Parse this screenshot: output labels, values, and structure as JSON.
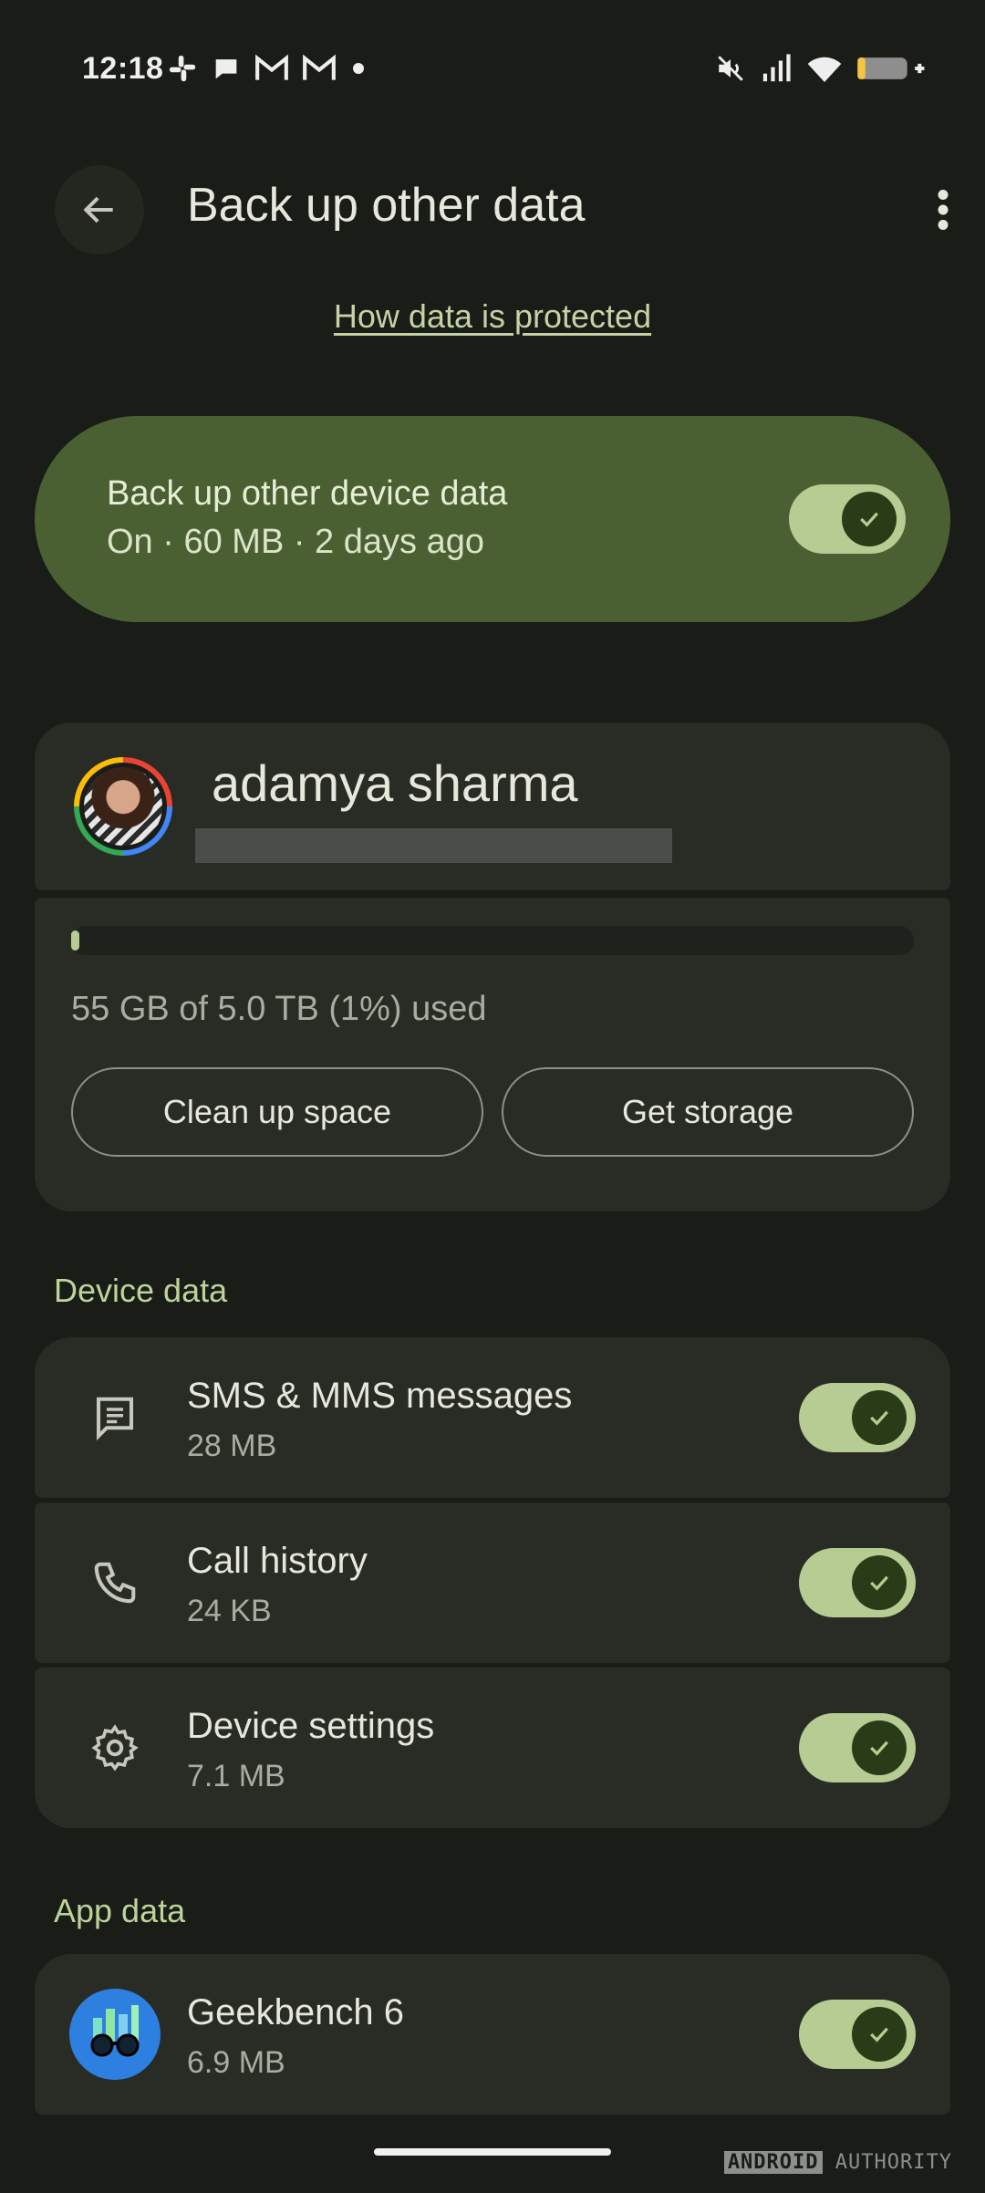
{
  "status_bar": {
    "time": "12:18",
    "left_icons": [
      "slack-icon",
      "chat-bubble-icon",
      "gmail-icon",
      "gmail-icon",
      "dot-icon"
    ],
    "right_icons": [
      "mute-icon",
      "signal-icon",
      "wifi-icon",
      "battery-charging-icon"
    ]
  },
  "header": {
    "title": "Back up other data",
    "back_icon": "arrow-left-icon",
    "more_icon": "more-vertical-icon"
  },
  "protection_link": "How data is protected",
  "backup_toggle": {
    "title": "Back up other device data",
    "subtitle": "On · 60 MB · 2 days ago",
    "enabled": true,
    "accent_color": "#4b6032"
  },
  "account": {
    "name": "adamya sharma"
  },
  "storage": {
    "summary": "55 GB of 5.0 TB (1%) used",
    "used_fraction": 0.01,
    "clean_up_label": "Clean up space",
    "get_storage_label": "Get storage"
  },
  "device_data": {
    "label": "Device data",
    "items": [
      {
        "title": "SMS & MMS messages",
        "size": "28 MB",
        "icon": "message-icon",
        "enabled": true
      },
      {
        "title": "Call history",
        "size": "24 KB",
        "icon": "phone-icon",
        "enabled": true
      },
      {
        "title": "Device settings",
        "size": "7.1 MB",
        "icon": "gear-icon",
        "enabled": true
      }
    ]
  },
  "app_data": {
    "label": "App data",
    "items": [
      {
        "title": "Geekbench 6",
        "size": "6.9 MB",
        "icon": "geekbench-icon",
        "enabled": true
      }
    ]
  },
  "watermark": {
    "left": "ANDROID",
    "right": "AUTHORITY"
  }
}
